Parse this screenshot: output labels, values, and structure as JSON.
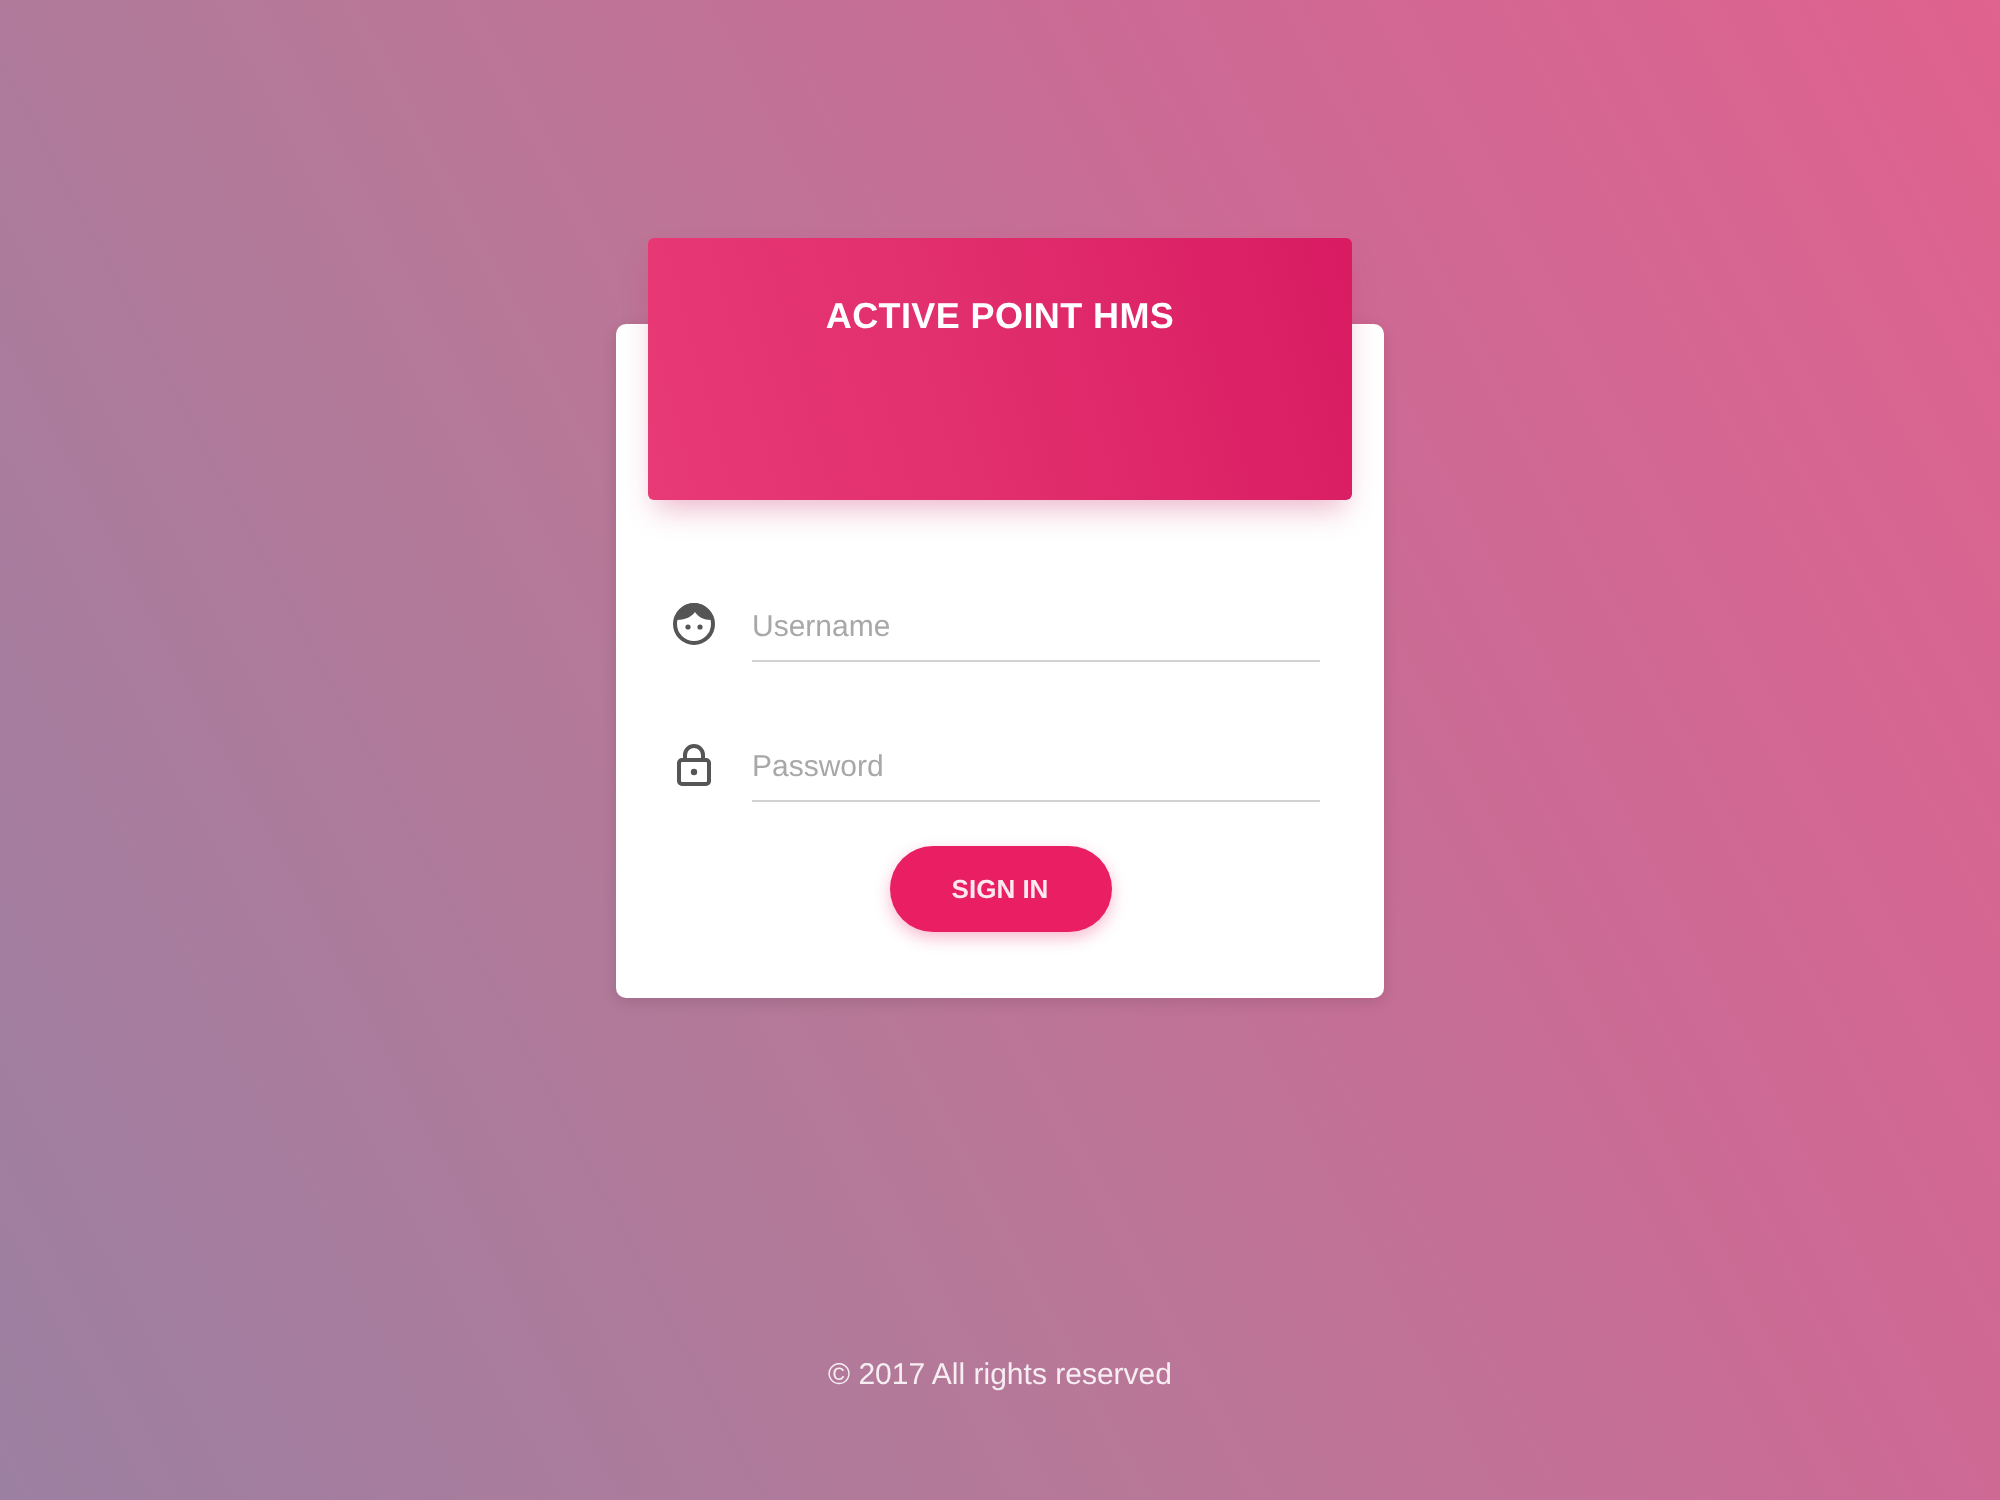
{
  "header": {
    "title": "ACTIVE POINT HMS"
  },
  "fields": [
    {
      "kind": "username",
      "placeholder": "Username"
    },
    {
      "kind": "password",
      "placeholder": "Password"
    }
  ],
  "button": {
    "label": "SIGN IN"
  },
  "footer": {
    "text": "© 2017 All rights reserved"
  }
}
